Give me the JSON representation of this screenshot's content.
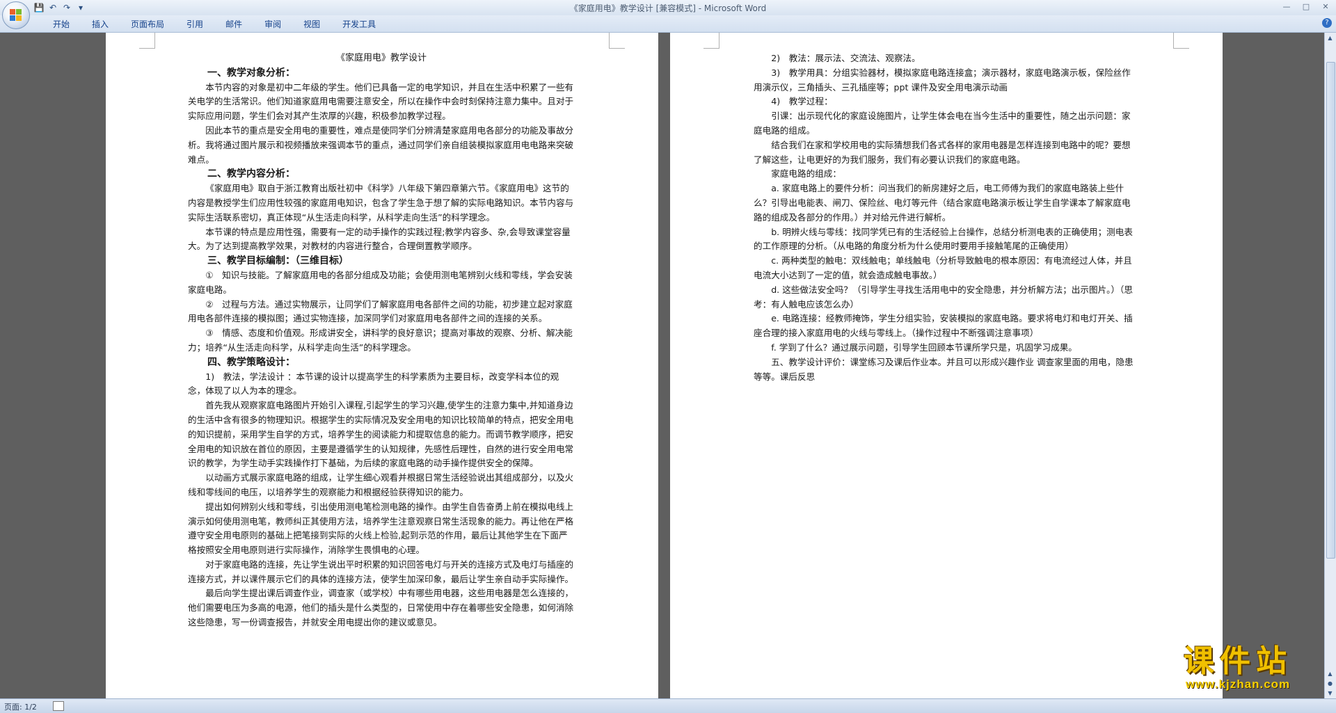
{
  "window": {
    "title": "《家庭用电》教学设计 [兼容模式] - Microsoft Word"
  },
  "ribbon": {
    "tabs": [
      "开始",
      "插入",
      "页面布局",
      "引用",
      "邮件",
      "审阅",
      "视图",
      "开发工具"
    ]
  },
  "status": {
    "page": "页面: 1/2"
  },
  "watermark": {
    "big": "课件站",
    "small": "www.kjzhan.com"
  },
  "document": {
    "title": "《家庭用电》教学设计",
    "left": [
      {
        "type": "h",
        "text": "一、教学对象分析："
      },
      {
        "type": "p",
        "text": "本节内容的对象是初中二年级的学生。他们已具备一定的电学知识，并且在生活中积累了一些有关电学的生活常识。他们知道家庭用电需要注意安全，所以在操作中会时刻保持注意力集中。且对于实际应用问题，学生们会对其产生浓厚的兴趣，积极参加教学过程。"
      },
      {
        "type": "p",
        "text": "因此本节的重点是安全用电的重要性，难点是使同学们分辨清楚家庭用电各部分的功能及事故分析。我将通过图片展示和视频播放来强调本节的重点，通过同学们亲自组装模拟家庭用电电路来突破难点。"
      },
      {
        "type": "h",
        "text": "二、教学内容分析："
      },
      {
        "type": "p",
        "text": "《家庭用电》取自于浙江教育出版社初中《科学》八年级下第四章第六节。《家庭用电》这节的内容是教授学生们应用性较强的家庭用电知识，包含了学生急于想了解的实际电路知识。本节内容与实际生活联系密切，真正体现“从生活走向科学，从科学走向生活”的科学理念。"
      },
      {
        "type": "p",
        "text": "本节课的特点是应用性强，需要有一定的动手操作的实践过程;教学内容多、杂,会导致课堂容量大。为了达到提高教学效果，对教材的内容进行整合，合理倒置教学顺序。"
      },
      {
        "type": "h",
        "text": "三、教学目标编制：（三维目标）"
      },
      {
        "type": "p",
        "text": "①　知识与技能。了解家庭用电的各部分组成及功能；会使用测电笔辨别火线和零线，学会安装家庭电路。"
      },
      {
        "type": "p",
        "text": "②　过程与方法。通过实物展示，让同学们了解家庭用电各部件之间的功能，初步建立起对家庭用电各部件连接的模拟图；通过实物连接，加深同学们对家庭用电各部件之间的连接的关系。"
      },
      {
        "type": "p",
        "text": "③　情感、态度和价值观。形成讲安全，讲科学的良好意识；提高对事故的观察、分析、解决能力；培养“从生活走向科学，从科学走向生活”的科学理念。"
      },
      {
        "type": "h",
        "text": "四、教学策略设计："
      },
      {
        "type": "p",
        "text": "1)　教法，学法设计 ：本节课的设计以提高学生的科学素质为主要目标，改变学科本位的观念，体现了以人为本的理念。"
      },
      {
        "type": "p",
        "text": "首先我从观察家庭电路图片开始引入课程,引起学生的学习兴趣,使学生的注意力集中,并知道身边的生活中含有很多的物理知识。根据学生的实际情况及安全用电的知识比较简单的特点，把安全用电的知识提前，采用学生自学的方式，培养学生的阅读能力和提取信息的能力。而调节教学顺序，把安全用电的知识放在首位的原因，主要是遵循学生的认知规律，先感性后理性，自然的进行安全用电常识的教学，为学生动手实践操作打下基础，为后续的家庭电路的动手操作提供安全的保障。"
      },
      {
        "type": "p",
        "text": "以动画方式展示家庭电路的组成，让学生细心观看并根据日常生活经验说出其组成部分，以及火线和零线间的电压，以培养学生的观察能力和根据经验获得知识的能力。"
      },
      {
        "type": "p",
        "text": "提出如何辨别火线和零线，引出使用测电笔检测电路的操作。由学生自告奋勇上前在模拟电线上演示如何使用测电笔，教师纠正其使用方法，培养学生注意观察日常生活现象的能力。再让他在严格遵守安全用电原则的基础上把笔接到实际的火线上检验,起到示范的作用，最后让其他学生在下面严格按照安全用电原则进行实际操作，消除学生畏惧电的心理。"
      },
      {
        "type": "p",
        "text": "对于家庭电路的连接，先让学生说出平时积累的知识回答电灯与开关的连接方式及电灯与插座的连接方式，并以课件展示它们的具体的连接方法，使学生加深印象，最后让学生亲自动手实际操作。"
      },
      {
        "type": "p",
        "text": "最后向学生提出课后调查作业，调查家（或学校）中有哪些用电器，这些用电器是怎么连接的，他们需要电压为多高的电源，他们的插头是什么类型的，日常使用中存在着哪些安全隐患，如何消除这些隐患，写一份调查报告，并就安全用电提出你的建议或意见。"
      }
    ],
    "right": [
      {
        "type": "p",
        "text": "2)　教法：展示法、交流法、观察法。"
      },
      {
        "type": "p",
        "text": "3)　教学用具：分组实验器材，模拟家庭电路连接盒；演示器材，家庭电路演示板，保险丝作用演示仪，三角插头、三孔插座等；ppt 课件及安全用电演示动画"
      },
      {
        "type": "p",
        "text": "4)　教学过程："
      },
      {
        "type": "p",
        "text": "引课：出示现代化的家庭设施图片，让学生体会电在当今生活中的重要性，随之出示问题：家庭电路的组成。"
      },
      {
        "type": "p",
        "text": "结合我们在家和学校用电的实际猜想我们各式各样的家用电器是怎样连接到电路中的呢？要想了解这些，让电更好的为我们服务，我们有必要认识我们的家庭电路。"
      },
      {
        "type": "p",
        "text": "家庭电路的组成："
      },
      {
        "type": "p",
        "text": "a. 家庭电路上的要件分析：问当我们的新房建好之后，电工师傅为我们的家庭电路装上些什么？引导出电能表、闸刀、保险丝、电灯等元件（结合家庭电路演示板让学生自学课本了解家庭电路的组成及各部分的作用。）并对给元件进行解析。"
      },
      {
        "type": "p",
        "text": "b. 明辨火线与零线：找同学凭已有的生活经验上台操作，总结分析测电表的正确使用；测电表的工作原理的分析。（从电路的角度分析为什么使用时要用手接触笔尾的正确使用）"
      },
      {
        "type": "p",
        "text": "c. 两种类型的触电：双线触电；单线触电（分析导致触电的根本原因：有电流经过人体，并且电流大小达到了一定的值，就会造成触电事故。）"
      },
      {
        "type": "p",
        "text": "d. 这些做法安全吗？（引导学生寻找生活用电中的安全隐患，并分析解方法；出示图片。）（思考：有人触电应该怎么办）"
      },
      {
        "type": "p",
        "text": "e. 电路连接：经教师掩饰，学生分组实验，安装模拟的家庭电路。要求将电灯和电灯开关、插座合理的接入家庭用电的火线与零线上。（操作过程中不断强调注意事项）"
      },
      {
        "type": "p",
        "text": "f. 学到了什么？通过展示问题，引导学生回顾本节课所学只是，巩固学习成果。"
      },
      {
        "type": "p",
        "text": "五、教学设计评价：课堂练习及课后作业本。并且可以形成兴趣作业 调查家里面的用电，隐患等等。课后反思"
      }
    ]
  }
}
